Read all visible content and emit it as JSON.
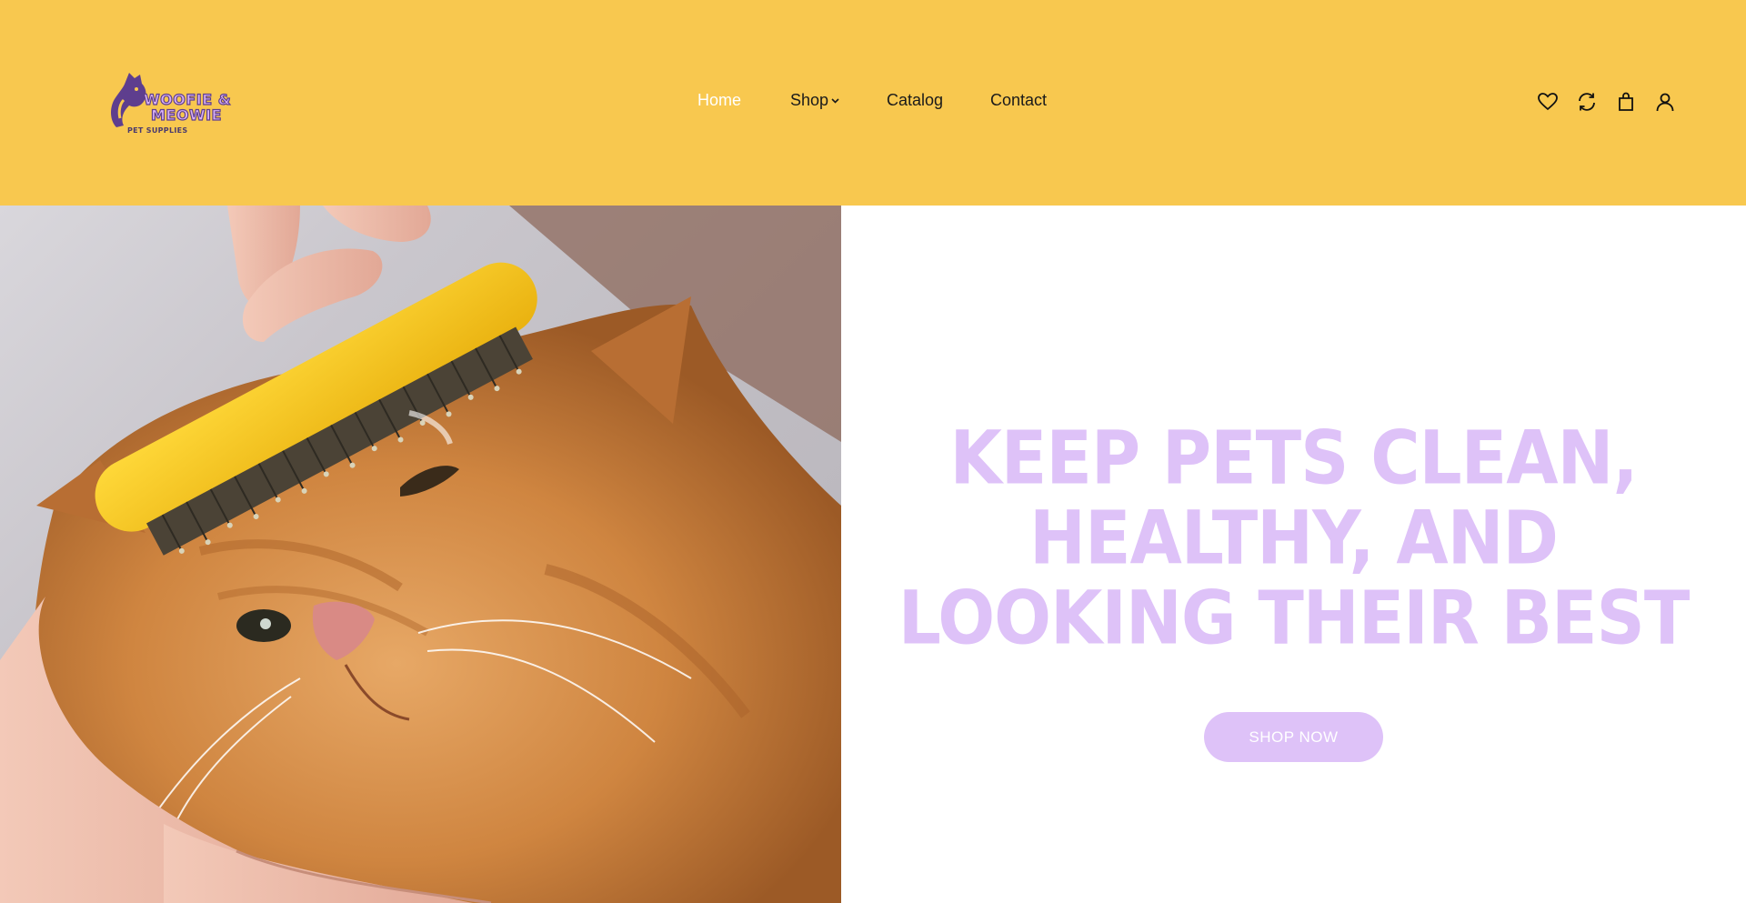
{
  "logo": {
    "line1": "WOOFIE &",
    "line2": "MEOWIE",
    "tagline": "PET SUPPLIES"
  },
  "nav": {
    "items": [
      {
        "label": "Home",
        "active": true
      },
      {
        "label": "Shop",
        "has_dropdown": true
      },
      {
        "label": "Catalog"
      },
      {
        "label": "Contact"
      }
    ]
  },
  "header_icons": [
    "heart-icon",
    "refresh-icon",
    "shopping-bag-icon",
    "user-icon"
  ],
  "hero": {
    "headline_lines": [
      "KEEP PETS CLEAN,",
      "HEALTHY, AND",
      "LOOKING THEIR BEST"
    ],
    "cta_label": "SHOP NOW",
    "image_subject": "orange cat being brushed with a yellow grooming brush"
  },
  "colors": {
    "header_bg": "#F8C84F",
    "accent_lavender": "#DEC2F8",
    "logo_purple": "#5E3E8E",
    "brush_yellow": "#F6C21A",
    "cat_orange": "#D98B45"
  }
}
